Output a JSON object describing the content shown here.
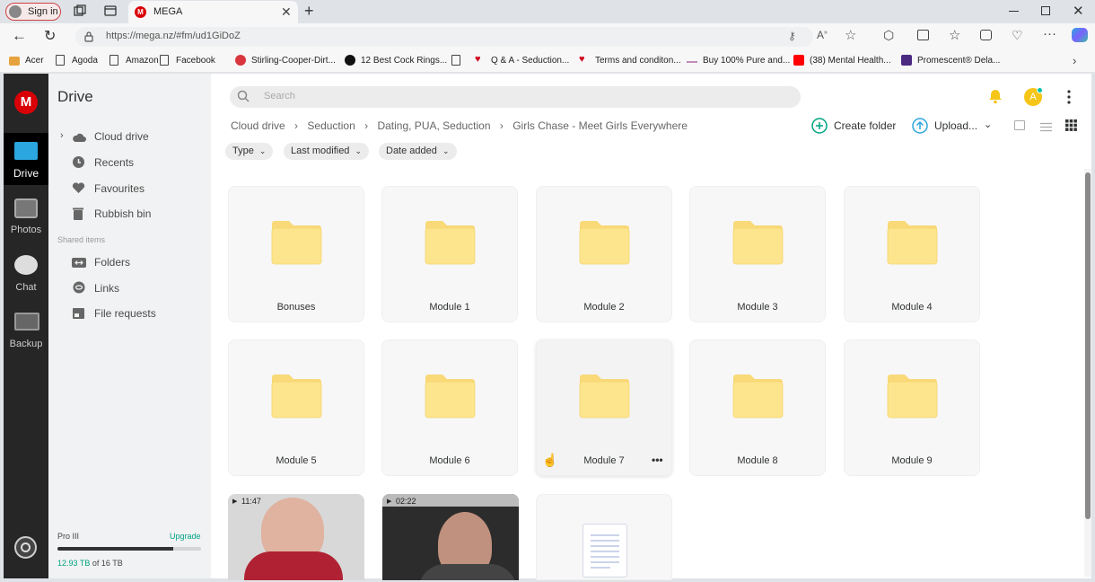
{
  "browser": {
    "sign_in": "Sign in",
    "tab_title": "MEGA",
    "url": "https://mega.nz/#fm/ud1GiDoZ",
    "bookmarks": [
      {
        "label": "Acer",
        "icon": "folder-icon",
        "color": "#e6a23c"
      },
      {
        "label": "Agoda",
        "icon": "page-icon",
        "color": "#444444"
      },
      {
        "label": "Amazon",
        "icon": "page-icon",
        "color": "#444444"
      },
      {
        "label": "Facebook",
        "icon": "page-icon",
        "color": "#444444"
      },
      {
        "label": "Stirling-Cooper-Dirt...",
        "icon": "red-logo-icon",
        "color": "#d9363e"
      },
      {
        "label": "12 Best Cock Rings...",
        "icon": "black-circle-icon",
        "color": "#111111"
      },
      {
        "label": "",
        "icon": "page-icon",
        "color": "#444444"
      },
      {
        "label": "Q & A - Seduction...",
        "icon": "heart-icon",
        "color": "#d0021b"
      },
      {
        "label": "Terms and conditon...",
        "icon": "heart-icon",
        "color": "#d0021b"
      },
      {
        "label": "Buy 100% Pure and...",
        "icon": "dash-icon",
        "color": "#c38ab7"
      },
      {
        "label": "(38) Mental Health...",
        "icon": "youtube-icon",
        "color": "#ff0000"
      },
      {
        "label": "Promescent® Dela...",
        "icon": "p-logo-icon",
        "color": "#4b2a82"
      }
    ]
  },
  "rail": {
    "drive": "Drive",
    "photos": "Photos",
    "chat": "Chat",
    "backup": "Backup"
  },
  "sidebar": {
    "title": "Drive",
    "items": [
      "Cloud drive",
      "Recents",
      "Favourites",
      "Rubbish bin"
    ],
    "shared_heading": "Shared items",
    "shared": [
      "Folders",
      "Links",
      "File requests"
    ],
    "plan": "Pro III",
    "upgrade": "Upgrade",
    "storage_used": "12.93 TB",
    "storage_total": "of 16 TB",
    "storage_fraction": 0.808
  },
  "topbar": {
    "search_placeholder": "Search",
    "avatar_letter": "A"
  },
  "breadcrumb": [
    "Cloud drive",
    "Seduction",
    "Dating, PUA, Seduction",
    "Girls Chase - Meet Girls Everywhere"
  ],
  "actions": {
    "create_folder": "Create folder",
    "upload": "Upload..."
  },
  "filters": [
    "Type",
    "Last modified",
    "Date added"
  ],
  "folders": [
    "Bonuses",
    "Module 1",
    "Module 2",
    "Module 3",
    "Module 4",
    "Module 5",
    "Module 6",
    "Module 7",
    "Module 8",
    "Module 9"
  ],
  "videos": [
    {
      "duration": "11:47"
    },
    {
      "duration": "02:22"
    }
  ],
  "colors": {
    "mega_red": "#d90007",
    "accent_green": "#00a382",
    "folder_yellow": "#fde58d",
    "upload_blue": "#2ba6de"
  }
}
